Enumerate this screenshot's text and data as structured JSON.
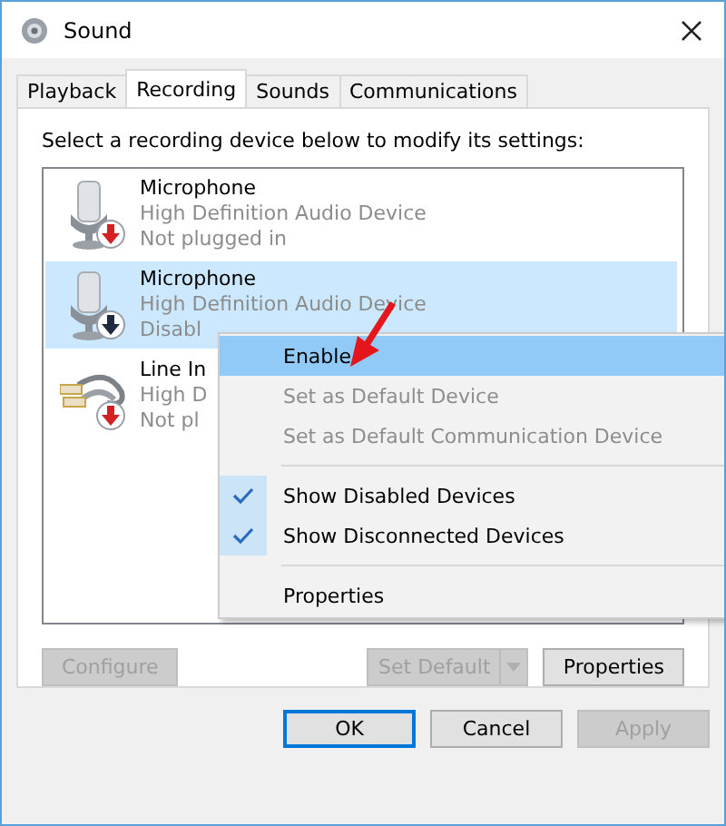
{
  "window": {
    "title": "Sound"
  },
  "tabs": [
    {
      "label": "Playback",
      "selected": false
    },
    {
      "label": "Recording",
      "selected": true
    },
    {
      "label": "Sounds",
      "selected": false
    },
    {
      "label": "Communications",
      "selected": false
    }
  ],
  "instruction": "Select a recording device below to modify its settings:",
  "devices": [
    {
      "kind": "microphone",
      "name": "Microphone",
      "line_2": "High Definition Audio Device",
      "line_3": "Not plugged in",
      "color": "#d42020",
      "selected": false
    },
    {
      "kind": "microphone",
      "name": "Microphone",
      "line_2": "High Definition Audio Device",
      "line_3": "Disabl",
      "color": "#1e2a40",
      "selected": true
    },
    {
      "kind": "line-in",
      "name": "Line In",
      "line_2": "High D",
      "line_3": "Not pl",
      "color": "#d42020",
      "selected": false
    }
  ],
  "context_menu": [
    {
      "kind": "item",
      "label": "Enable",
      "disabled": false,
      "checked": false,
      "selected": true
    },
    {
      "kind": "item",
      "label": "Set as Default Device",
      "disabled": true,
      "checked": false,
      "selected": false
    },
    {
      "kind": "item",
      "label": "Set as Default Communication Device",
      "disabled": true,
      "checked": false,
      "selected": false
    },
    {
      "kind": "separator"
    },
    {
      "kind": "item",
      "label": "Show Disabled Devices",
      "disabled": false,
      "checked": true,
      "selected": false
    },
    {
      "kind": "item",
      "label": "Show Disconnected Devices",
      "disabled": false,
      "checked": true,
      "selected": false
    },
    {
      "kind": "separator"
    },
    {
      "kind": "item",
      "label": "Properties",
      "disabled": false,
      "checked": false,
      "selected": false
    }
  ],
  "panel_buttons": {
    "configure": {
      "label": "Configure",
      "disabled": true
    },
    "set_default": {
      "label": "Set Default",
      "disabled": true
    },
    "properties": {
      "label": "Properties",
      "disabled": false
    }
  },
  "dialog_buttons": [
    {
      "label": "OK",
      "disabled": false,
      "focused": true
    },
    {
      "label": "Cancel",
      "disabled": false,
      "focused": false
    },
    {
      "label": "Apply",
      "disabled": true,
      "focused": false
    }
  ]
}
